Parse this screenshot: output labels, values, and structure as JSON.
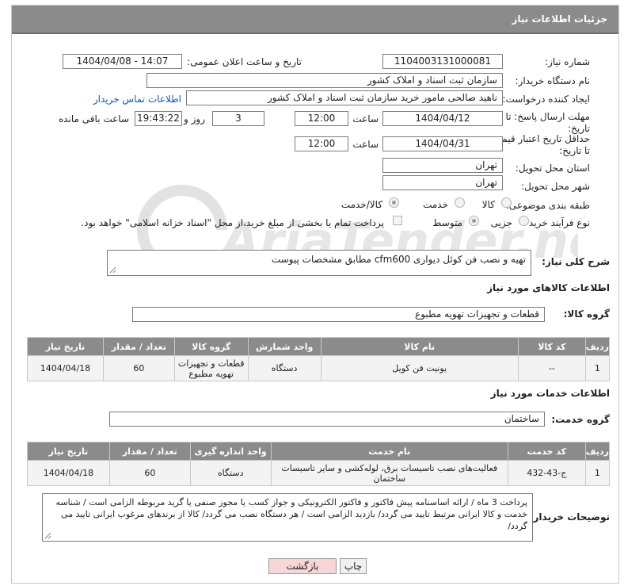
{
  "header": {
    "title": "جزئیات اطلاعات نیاز"
  },
  "form": {
    "need_number_label": "شماره نیاز:",
    "need_number": "1104003131000081",
    "announce_label": "تاریخ و ساعت اعلان عمومی:",
    "announce_value": "1404/04/08 - 14:07",
    "buyer_org_label": "نام دستگاه خریدار:",
    "buyer_org": "سازمان ثبت اسناد و املاک کشور",
    "requester_label": "ایجاد کننده درخواست:",
    "requester": "ناهید صالحی مامور خرید سازمان ثبت اسناد و املاک کشور",
    "contact_link": "اطلاعات تماس خریدار",
    "send_deadline_label_1": "مهلت ارسال پاسخ: تا",
    "send_deadline_label_2": "تاریخ:",
    "send_deadline_date": "1404/04/12",
    "time_label": "ساعت",
    "send_deadline_time": "12:00",
    "days_value": "3",
    "days_label": "روز و",
    "remaining_time": "19:43:22",
    "remaining_label": "ساعت باقی مانده",
    "price_deadline_label_1": "حداقل تاریخ اعتبار قیمت:",
    "price_deadline_label_2": "تا تاریخ:",
    "price_deadline_date": "1404/04/31",
    "price_deadline_time": "12:00",
    "province_label": "استان محل تحویل:",
    "province": "تهران",
    "city_label": "شهر محل تحویل:",
    "city": "تهران",
    "category_label": "طبقه بندی موضوعی:",
    "category_options": [
      "کالا",
      "خدمت",
      "کالا/خدمت"
    ],
    "category_selected": "کالا/خدمت",
    "process_label": "نوع فرآیند خرید :",
    "process_options": [
      "جزیی",
      "متوسط"
    ],
    "process_selected": "متوسط",
    "payment_note": "پرداخت تمام یا بخشی از مبلغ خرید،از محل \"اسناد خزانه اسلامی\" خواهد بود."
  },
  "description": {
    "label": "شرح کلی نیاز:",
    "text": "تهیه و نصب فن کوئل دیواری cfm600 مطابق مشخصات پیوست"
  },
  "goods": {
    "section_title": "اطلاعات کالاهای مورد نیاز",
    "group_label": "گروه کالا:",
    "group_value": "قطعات و تجهیزات تهویه مطبوع",
    "columns": [
      "ردیف",
      "کد کالا",
      "نام کالا",
      "واحد شمارش",
      "گروه کالا",
      "تعداد / مقدار",
      "تاریخ نیاز"
    ],
    "rows": [
      {
        "row": "1",
        "code": "--",
        "name": "یونیت فن کویل",
        "unit": "دستگاه",
        "group": "قطعات و تجهیزات تهویه مطبوع",
        "qty": "60",
        "date": "1404/04/18"
      }
    ]
  },
  "services": {
    "section_title": "اطلاعات خدمات مورد نیاز",
    "group_label": "گروه خدمت:",
    "group_value": "ساختمان",
    "columns": [
      "ردیف",
      "کد خدمت",
      "نام خدمت",
      "واحد اندازه گیری",
      "تعداد / مقدار",
      "تاریخ نیاز"
    ],
    "rows": [
      {
        "row": "1",
        "code": "ج-43-432",
        "name": "فعالیت‌های نصب تاسیسات برق، لوله‌کشی و سایر تاسیسات ساختمان",
        "unit": "دستگاه",
        "qty": "60",
        "date": "1404/04/18"
      }
    ]
  },
  "buyer_notes": {
    "label": "توضیحات خریدار:",
    "text": "پرداخت 3 ماه / ارائه اساسنامه پیش فاکتور و فاکتور الکترونیکی و جواز کسب یا مجوز صنفی یا گرید مربوطه الزامی است / شناسه خدمت و کالا ایرانی مرتبط تایید می گردد/ بازدید الزامی است / هر دستگاه نصب می گردد/ کالا از برندهای مرغوب ایرانی تایید می گردد/"
  },
  "buttons": {
    "print": "چاپ",
    "back": "بازگشت"
  },
  "watermark": {
    "text": "AriaTender.net"
  },
  "colors": {
    "header": "#8b8b8b",
    "link": "#1a57b3",
    "back_button": "#f7d6d6"
  }
}
